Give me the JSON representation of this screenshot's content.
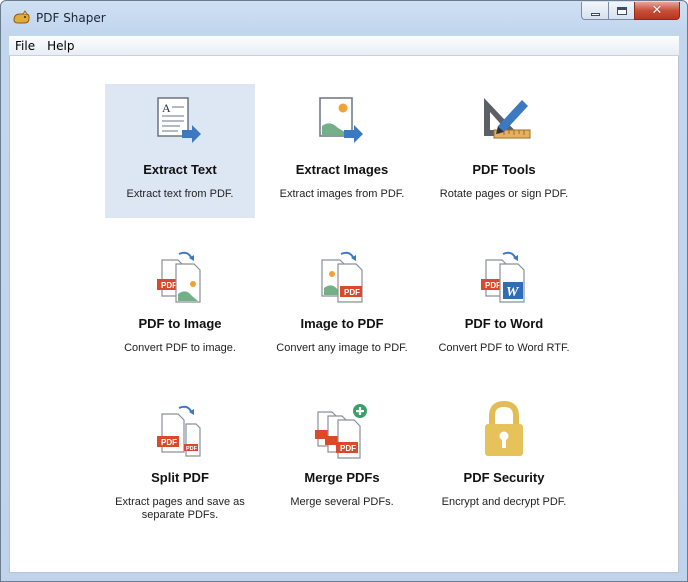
{
  "window": {
    "title": "PDF Shaper"
  },
  "menu": {
    "file": "File",
    "help": "Help"
  },
  "tiles": [
    {
      "name": "Extract Text",
      "desc": "Extract text from PDF.",
      "selected": true,
      "icon": "extract-text-icon"
    },
    {
      "name": "Extract Images",
      "desc": "Extract images from PDF.",
      "icon": "extract-images-icon"
    },
    {
      "name": "PDF Tools",
      "desc": "Rotate pages or sign PDF.",
      "icon": "pdf-tools-icon"
    },
    {
      "name": "PDF to Image",
      "desc": "Convert PDF to image.",
      "icon": "pdf-to-image-icon"
    },
    {
      "name": "Image to PDF",
      "desc": "Convert any image to PDF.",
      "icon": "image-to-pdf-icon"
    },
    {
      "name": "PDF to Word",
      "desc": "Convert PDF to Word RTF.",
      "icon": "pdf-to-word-icon"
    },
    {
      "name": "Split PDF",
      "desc": "Extract pages and save as separate PDFs.",
      "icon": "split-pdf-icon"
    },
    {
      "name": "Merge PDFs",
      "desc": "Merge several PDFs.",
      "icon": "merge-pdfs-icon"
    },
    {
      "name": "PDF Security",
      "desc": "Encrypt and decrypt PDF.",
      "icon": "padlock-icon"
    }
  ],
  "icon_labels": {
    "pdf": "PDF",
    "word": "W",
    "text_glyph": "A"
  },
  "colors": {
    "pdf_red": "#d84a2b",
    "arrow_blue": "#3d79c2",
    "lock_gold": "#e6c35a",
    "selected_bg": "#dde7f4"
  }
}
